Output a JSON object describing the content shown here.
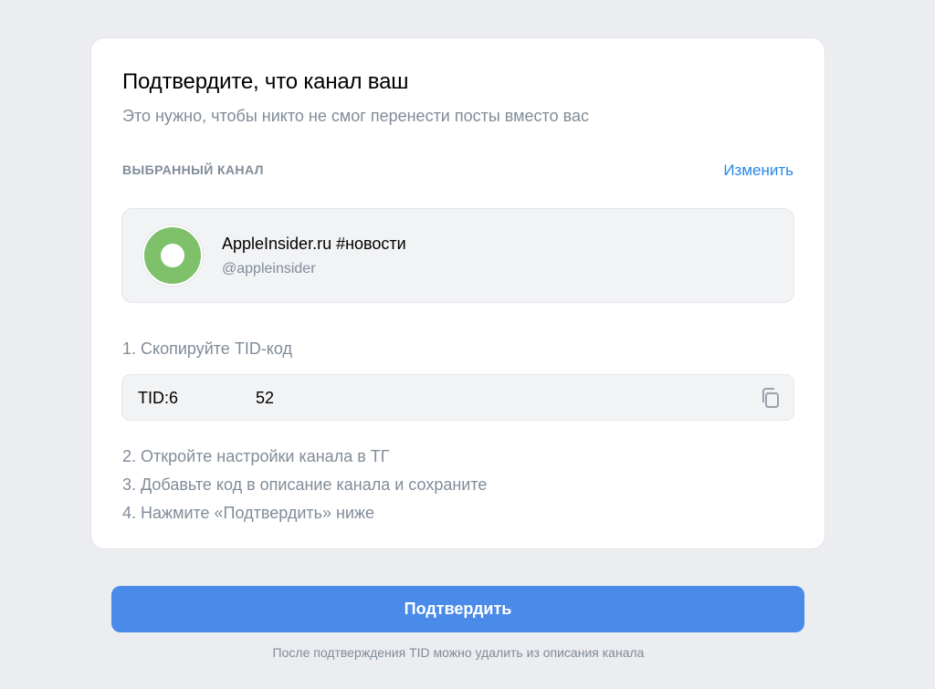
{
  "card": {
    "title": "Подтвердите, что канал ваш",
    "subtitle": "Это нужно, чтобы никто не смог перенести посты вместо вас",
    "section_label": "ВЫБРАННЫЙ КАНАЛ",
    "change_label": "Изменить"
  },
  "channel": {
    "name": "AppleInsider.ru #новости",
    "handle": "@appleinsider",
    "avatar_color": "#7ec16a"
  },
  "steps": {
    "step1": "1. Скопируйте TID-код",
    "tid_value": "TID:6                 52",
    "step2": "2. Откройте настройки канала в ТГ",
    "step3": "3. Добавьте код в описание канала и сохраните",
    "step4": "4. Нажмите «Подтвердить» ниже"
  },
  "actions": {
    "confirm_label": "Подтвердить",
    "footnote": "После подтверждения TID можно удалить из описания канала"
  },
  "icons": {
    "copy": "copy-icon"
  },
  "colors": {
    "accent": "#2688eb",
    "button": "#4a8ae8",
    "muted_text": "#818c99",
    "background": "#ebedf0"
  }
}
